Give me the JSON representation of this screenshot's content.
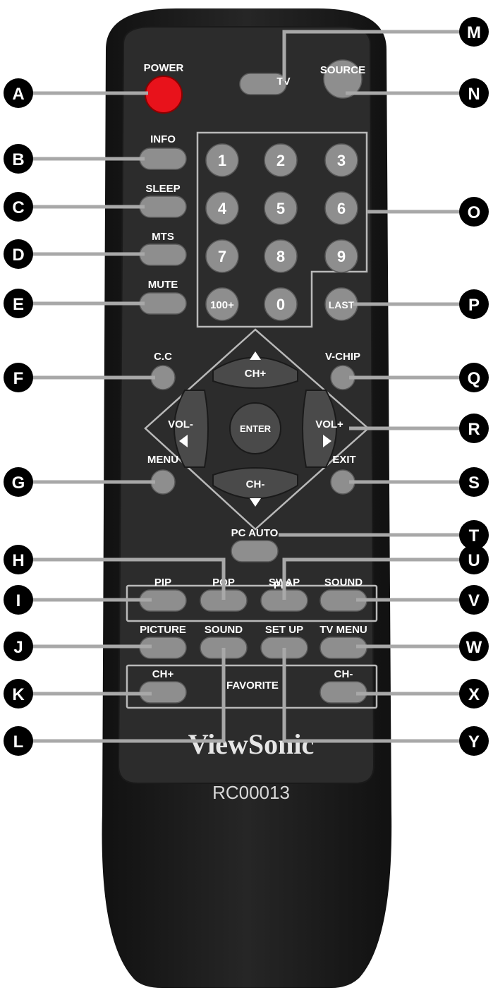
{
  "remote": {
    "brand": "ViewSonic",
    "model": "RC00013",
    "buttons": {
      "power": "POWER",
      "tv": "TV",
      "source": "SOURCE",
      "info": "INFO",
      "sleep": "SLEEP",
      "mts": "MTS",
      "mute": "MUTE",
      "cc": "C.C",
      "vchip": "V-CHIP",
      "menu": "MENU",
      "exit": "EXIT",
      "ch_up": "CH+",
      "ch_down": "CH-",
      "vol_down": "VOL-",
      "vol_up": "VOL+",
      "enter": "ENTER",
      "pc_auto": "PC AUTO",
      "pip_group": "PIP",
      "pip": "PIP",
      "pop": "POP",
      "swap": "SWAP",
      "pip_sound": "SOUND",
      "picture": "PICTURE",
      "sound": "SOUND",
      "setup": "SET UP",
      "tv_menu": "TV MENU",
      "fav_ch_up": "CH+",
      "favorite": "FAVORITE",
      "fav_ch_down": "CH-"
    },
    "numpad": [
      "1",
      "2",
      "3",
      "4",
      "5",
      "6",
      "7",
      "8",
      "9",
      "100+",
      "0",
      "LAST"
    ]
  },
  "callouts": {
    "A": "A",
    "B": "B",
    "C": "C",
    "D": "D",
    "E": "E",
    "F": "F",
    "G": "G",
    "H": "H",
    "I": "I",
    "J": "J",
    "K": "K",
    "L": "L",
    "M": "M",
    "N": "N",
    "O": "O",
    "P": "P",
    "Q": "Q",
    "R": "R",
    "S": "S",
    "T": "T",
    "U": "U",
    "V": "V",
    "W": "W",
    "X": "X",
    "Y": "Y"
  },
  "colors": {
    "body": "#1e1e1e",
    "face": "#2c2c2c",
    "button": "#8e8e8e",
    "power": "#e8121b",
    "callout": "#000000",
    "leader": "#a8a8a8"
  }
}
